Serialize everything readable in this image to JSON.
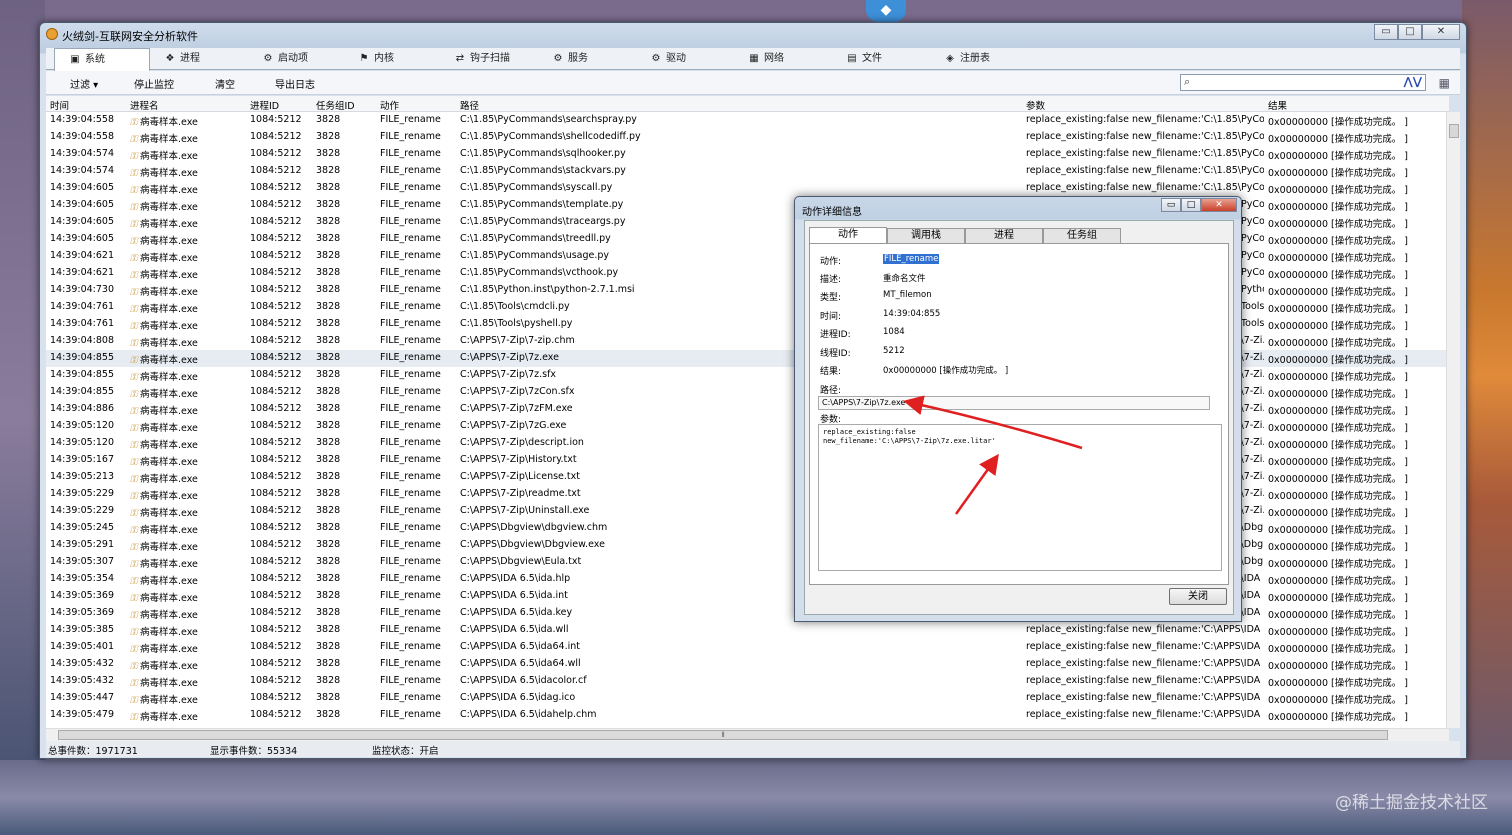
{
  "window": {
    "title": "火绒剑-互联网安全分析软件",
    "minimize": "▭",
    "maximize": "□",
    "close": "✕"
  },
  "tabs": [
    {
      "label": "系统",
      "icon": "▣",
      "active": true
    },
    {
      "label": "进程",
      "icon": "❖"
    },
    {
      "label": "启动项",
      "icon": "⚙"
    },
    {
      "label": "内核",
      "icon": "⚑"
    },
    {
      "label": "钩子扫描",
      "icon": "⇄"
    },
    {
      "label": "服务",
      "icon": "⚙"
    },
    {
      "label": "驱动",
      "icon": "⚙"
    },
    {
      "label": "网络",
      "icon": "▦"
    },
    {
      "label": "文件",
      "icon": "▤"
    },
    {
      "label": "注册表",
      "icon": "◈"
    }
  ],
  "toolbar": {
    "filter": "过滤 ▾",
    "stop": "停止监控",
    "clear": "清空",
    "export": "导出日志",
    "search_value": "",
    "search_icon": "⌕",
    "search_nav": "⋀⋁",
    "grid_icon": "▦"
  },
  "columns": {
    "time": "时间",
    "proc": "进程名",
    "pid": "进程ID",
    "tgid": "任务组ID",
    "action": "动作",
    "path": "路径",
    "param": "参数",
    "result": "结果"
  },
  "rows": [
    {
      "time": "14:39:04:558",
      "proc": "病毒样本.exe",
      "pid": "1084:5212",
      "tgid": "3828",
      "action": "FILE_rename",
      "path": "C:\\1.85\\PyCommands\\searchspray.py",
      "param": "replace_existing:false new_filename:'C:\\1.85\\PyCo...",
      "result": "0x00000000 [操作成功完成。 ]"
    },
    {
      "time": "14:39:04:558",
      "proc": "病毒样本.exe",
      "pid": "1084:5212",
      "tgid": "3828",
      "action": "FILE_rename",
      "path": "C:\\1.85\\PyCommands\\shellcodediff.py",
      "param": "replace_existing:false new_filename:'C:\\1.85\\PyCo...",
      "result": "0x00000000 [操作成功完成。 ]"
    },
    {
      "time": "14:39:04:574",
      "proc": "病毒样本.exe",
      "pid": "1084:5212",
      "tgid": "3828",
      "action": "FILE_rename",
      "path": "C:\\1.85\\PyCommands\\sqlhooker.py",
      "param": "replace_existing:false new_filename:'C:\\1.85\\PyCo...",
      "result": "0x00000000 [操作成功完成。 ]"
    },
    {
      "time": "14:39:04:574",
      "proc": "病毒样本.exe",
      "pid": "1084:5212",
      "tgid": "3828",
      "action": "FILE_rename",
      "path": "C:\\1.85\\PyCommands\\stackvars.py",
      "param": "replace_existing:false new_filename:'C:\\1.85\\PyCo...",
      "result": "0x00000000 [操作成功完成。 ]"
    },
    {
      "time": "14:39:04:605",
      "proc": "病毒样本.exe",
      "pid": "1084:5212",
      "tgid": "3828",
      "action": "FILE_rename",
      "path": "C:\\1.85\\PyCommands\\syscall.py",
      "param": "replace_existing:false new_filename:'C:\\1.85\\PyCo...",
      "result": "0x00000000 [操作成功完成。 ]"
    },
    {
      "time": "14:39:04:605",
      "proc": "病毒样本.exe",
      "pid": "1084:5212",
      "tgid": "3828",
      "action": "FILE_rename",
      "path": "C:\\1.85\\PyCommands\\template.py",
      "param": "replace_existing:false new_filename:'C:\\1.85\\PyCo...",
      "result": "0x00000000 [操作成功完成。 ]"
    },
    {
      "time": "14:39:04:605",
      "proc": "病毒样本.exe",
      "pid": "1084:5212",
      "tgid": "3828",
      "action": "FILE_rename",
      "path": "C:\\1.85\\PyCommands\\traceargs.py",
      "param": "replace_existing:false new_filename:'C:\\1.85\\PyCo...",
      "result": "0x00000000 [操作成功完成。 ]"
    },
    {
      "time": "14:39:04:605",
      "proc": "病毒样本.exe",
      "pid": "1084:5212",
      "tgid": "3828",
      "action": "FILE_rename",
      "path": "C:\\1.85\\PyCommands\\treedll.py",
      "param": "replace_existing:false new_filename:'C:\\1.85\\PyCo...",
      "result": "0x00000000 [操作成功完成。 ]"
    },
    {
      "time": "14:39:04:621",
      "proc": "病毒样本.exe",
      "pid": "1084:5212",
      "tgid": "3828",
      "action": "FILE_rename",
      "path": "C:\\1.85\\PyCommands\\usage.py",
      "param": "replace_existing:false new_filename:'C:\\1.85\\PyCo...",
      "result": "0x00000000 [操作成功完成。 ]"
    },
    {
      "time": "14:39:04:621",
      "proc": "病毒样本.exe",
      "pid": "1084:5212",
      "tgid": "3828",
      "action": "FILE_rename",
      "path": "C:\\1.85\\PyCommands\\vcthook.py",
      "param": "replace_existing:false new_filename:'C:\\1.85\\PyCo...",
      "result": "0x00000000 [操作成功完成。 ]"
    },
    {
      "time": "14:39:04:730",
      "proc": "病毒样本.exe",
      "pid": "1084:5212",
      "tgid": "3828",
      "action": "FILE_rename",
      "path": "C:\\1.85\\Python.inst\\python-2.7.1.msi",
      "param": "replace_existing:false new_filename:'C:\\1.85\\Pytho...",
      "result": "0x00000000 [操作成功完成。 ]"
    },
    {
      "time": "14:39:04:761",
      "proc": "病毒样本.exe",
      "pid": "1084:5212",
      "tgid": "3828",
      "action": "FILE_rename",
      "path": "C:\\1.85\\Tools\\cmdcli.py",
      "param": "replace_existing:false new_filename:'C:\\1.85\\Tools...",
      "result": "0x00000000 [操作成功完成。 ]"
    },
    {
      "time": "14:39:04:761",
      "proc": "病毒样本.exe",
      "pid": "1084:5212",
      "tgid": "3828",
      "action": "FILE_rename",
      "path": "C:\\1.85\\Tools\\pyshell.py",
      "param": "replace_existing:false new_filename:'C:\\1.85\\Tools...",
      "result": "0x00000000 [操作成功完成。 ]"
    },
    {
      "time": "14:39:04:808",
      "proc": "病毒样本.exe",
      "pid": "1084:5212",
      "tgid": "3828",
      "action": "FILE_rename",
      "path": "C:\\APPS\\7-Zip\\7-zip.chm",
      "param": "replace_existing:false new_filename:'C:\\APPS\\7-Zi...",
      "result": "0x00000000 [操作成功完成。 ]"
    },
    {
      "time": "14:39:04:855",
      "proc": "病毒样本.exe",
      "pid": "1084:5212",
      "tgid": "3828",
      "action": "FILE_rename",
      "path": "C:\\APPS\\7-Zip\\7z.exe",
      "param": "replace_existing:false new_filename:'C:\\APPS\\7-Zi...",
      "result": "0x00000000 [操作成功完成。 ]",
      "selected": true
    },
    {
      "time": "14:39:04:855",
      "proc": "病毒样本.exe",
      "pid": "1084:5212",
      "tgid": "3828",
      "action": "FILE_rename",
      "path": "C:\\APPS\\7-Zip\\7z.sfx",
      "param": "replace_existing:false new_filename:'C:\\APPS\\7-Zi...",
      "result": "0x00000000 [操作成功完成。 ]"
    },
    {
      "time": "14:39:04:855",
      "proc": "病毒样本.exe",
      "pid": "1084:5212",
      "tgid": "3828",
      "action": "FILE_rename",
      "path": "C:\\APPS\\7-Zip\\7zCon.sfx",
      "param": "replace_existing:false new_filename:'C:\\APPS\\7-Zi...",
      "result": "0x00000000 [操作成功完成。 ]"
    },
    {
      "time": "14:39:04:886",
      "proc": "病毒样本.exe",
      "pid": "1084:5212",
      "tgid": "3828",
      "action": "FILE_rename",
      "path": "C:\\APPS\\7-Zip\\7zFM.exe",
      "param": "replace_existing:false new_filename:'C:\\APPS\\7-Zi...",
      "result": "0x00000000 [操作成功完成。 ]"
    },
    {
      "time": "14:39:05:120",
      "proc": "病毒样本.exe",
      "pid": "1084:5212",
      "tgid": "3828",
      "action": "FILE_rename",
      "path": "C:\\APPS\\7-Zip\\7zG.exe",
      "param": "replace_existing:false new_filename:'C:\\APPS\\7-Zi...",
      "result": "0x00000000 [操作成功完成。 ]"
    },
    {
      "time": "14:39:05:120",
      "proc": "病毒样本.exe",
      "pid": "1084:5212",
      "tgid": "3828",
      "action": "FILE_rename",
      "path": "C:\\APPS\\7-Zip\\descript.ion",
      "param": "replace_existing:false new_filename:'C:\\APPS\\7-Zi...",
      "result": "0x00000000 [操作成功完成。 ]"
    },
    {
      "time": "14:39:05:167",
      "proc": "病毒样本.exe",
      "pid": "1084:5212",
      "tgid": "3828",
      "action": "FILE_rename",
      "path": "C:\\APPS\\7-Zip\\History.txt",
      "param": "replace_existing:false new_filename:'C:\\APPS\\7-Zi...",
      "result": "0x00000000 [操作成功完成。 ]"
    },
    {
      "time": "14:39:05:213",
      "proc": "病毒样本.exe",
      "pid": "1084:5212",
      "tgid": "3828",
      "action": "FILE_rename",
      "path": "C:\\APPS\\7-Zip\\License.txt",
      "param": "replace_existing:false new_filename:'C:\\APPS\\7-Zi...",
      "result": "0x00000000 [操作成功完成。 ]"
    },
    {
      "time": "14:39:05:229",
      "proc": "病毒样本.exe",
      "pid": "1084:5212",
      "tgid": "3828",
      "action": "FILE_rename",
      "path": "C:\\APPS\\7-Zip\\readme.txt",
      "param": "replace_existing:false new_filename:'C:\\APPS\\7-Zi...",
      "result": "0x00000000 [操作成功完成。 ]"
    },
    {
      "time": "14:39:05:229",
      "proc": "病毒样本.exe",
      "pid": "1084:5212",
      "tgid": "3828",
      "action": "FILE_rename",
      "path": "C:\\APPS\\7-Zip\\Uninstall.exe",
      "param": "replace_existing:false new_filename:'C:\\APPS\\7-Zi...",
      "result": "0x00000000 [操作成功完成。 ]"
    },
    {
      "time": "14:39:05:245",
      "proc": "病毒样本.exe",
      "pid": "1084:5212",
      "tgid": "3828",
      "action": "FILE_rename",
      "path": "C:\\APPS\\Dbgview\\dbgview.chm",
      "param": "replace_existing:false new_filename:'C:\\APPS\\Dbg...",
      "result": "0x00000000 [操作成功完成。 ]"
    },
    {
      "time": "14:39:05:291",
      "proc": "病毒样本.exe",
      "pid": "1084:5212",
      "tgid": "3828",
      "action": "FILE_rename",
      "path": "C:\\APPS\\Dbgview\\Dbgview.exe",
      "param": "replace_existing:false new_filename:'C:\\APPS\\Dbg...",
      "result": "0x00000000 [操作成功完成。 ]"
    },
    {
      "time": "14:39:05:307",
      "proc": "病毒样本.exe",
      "pid": "1084:5212",
      "tgid": "3828",
      "action": "FILE_rename",
      "path": "C:\\APPS\\Dbgview\\Eula.txt",
      "param": "replace_existing:false new_filename:'C:\\APPS\\Dbg...",
      "result": "0x00000000 [操作成功完成。 ]"
    },
    {
      "time": "14:39:05:354",
      "proc": "病毒样本.exe",
      "pid": "1084:5212",
      "tgid": "3828",
      "action": "FILE_rename",
      "path": "C:\\APPS\\IDA 6.5\\ida.hlp",
      "param": "replace_existing:false new_filename:'C:\\APPS\\IDA ...",
      "result": "0x00000000 [操作成功完成。 ]"
    },
    {
      "time": "14:39:05:369",
      "proc": "病毒样本.exe",
      "pid": "1084:5212",
      "tgid": "3828",
      "action": "FILE_rename",
      "path": "C:\\APPS\\IDA 6.5\\ida.int",
      "param": "replace_existing:false new_filename:'C:\\APPS\\IDA ...",
      "result": "0x00000000 [操作成功完成。 ]"
    },
    {
      "time": "14:39:05:369",
      "proc": "病毒样本.exe",
      "pid": "1084:5212",
      "tgid": "3828",
      "action": "FILE_rename",
      "path": "C:\\APPS\\IDA 6.5\\ida.key",
      "param": "replace_existing:false new_filename:'C:\\APPS\\IDA ...",
      "result": "0x00000000 [操作成功完成。 ]"
    },
    {
      "time": "14:39:05:385",
      "proc": "病毒样本.exe",
      "pid": "1084:5212",
      "tgid": "3828",
      "action": "FILE_rename",
      "path": "C:\\APPS\\IDA 6.5\\ida.wll",
      "param": "replace_existing:false new_filename:'C:\\APPS\\IDA ...",
      "result": "0x00000000 [操作成功完成。 ]"
    },
    {
      "time": "14:39:05:401",
      "proc": "病毒样本.exe",
      "pid": "1084:5212",
      "tgid": "3828",
      "action": "FILE_rename",
      "path": "C:\\APPS\\IDA 6.5\\ida64.int",
      "param": "replace_existing:false new_filename:'C:\\APPS\\IDA ...",
      "result": "0x00000000 [操作成功完成。 ]"
    },
    {
      "time": "14:39:05:432",
      "proc": "病毒样本.exe",
      "pid": "1084:5212",
      "tgid": "3828",
      "action": "FILE_rename",
      "path": "C:\\APPS\\IDA 6.5\\ida64.wll",
      "param": "replace_existing:false new_filename:'C:\\APPS\\IDA ...",
      "result": "0x00000000 [操作成功完成。 ]"
    },
    {
      "time": "14:39:05:432",
      "proc": "病毒样本.exe",
      "pid": "1084:5212",
      "tgid": "3828",
      "action": "FILE_rename",
      "path": "C:\\APPS\\IDA 6.5\\idacolor.cf",
      "param": "replace_existing:false new_filename:'C:\\APPS\\IDA ...",
      "result": "0x00000000 [操作成功完成。 ]"
    },
    {
      "time": "14:39:05:447",
      "proc": "病毒样本.exe",
      "pid": "1084:5212",
      "tgid": "3828",
      "action": "FILE_rename",
      "path": "C:\\APPS\\IDA 6.5\\idag.ico",
      "param": "replace_existing:false new_filename:'C:\\APPS\\IDA ...",
      "result": "0x00000000 [操作成功完成。 ]"
    },
    {
      "time": "14:39:05:479",
      "proc": "病毒样本.exe",
      "pid": "1084:5212",
      "tgid": "3828",
      "action": "FILE_rename",
      "path": "C:\\APPS\\IDA 6.5\\idahelp.chm",
      "param": "replace_existing:false new_filename:'C:\\APPS\\IDA ...",
      "result": "0x00000000 [操作成功完成。 ]"
    }
  ],
  "status": {
    "total": "总事件数：1971731",
    "shown": "显示事件数：55334",
    "monitor": "监控状态：开启"
  },
  "dialog": {
    "title": "动作详细信息",
    "tabs": [
      "动作",
      "调用栈",
      "进程",
      "任务组"
    ],
    "labels": {
      "action": "动作:",
      "desc": "描述:",
      "type": "类型:",
      "time": "时间:",
      "pid": "进程ID:",
      "tid": "线程ID:",
      "result": "结果:",
      "path": "路径:",
      "param": "参数:"
    },
    "values": {
      "action": "FILE_rename",
      "desc": "重命名文件",
      "type": "MT_filemon",
      "time": "14:39:04:855",
      "pid": "1084",
      "tid": "5212",
      "result": "0x00000000 [操作成功完成。 ]",
      "path": "C:\\APPS\\7-Zip\\7z.exe"
    },
    "param_lines": [
      "replace_existing:false",
      "new_filename:'C:\\APPS\\7-Zip\\7z.exe.litar'"
    ],
    "close": "关闭"
  },
  "watermark": "@稀土掘金技术社区",
  "colors": {
    "annotation_arrow": "#e02020",
    "selection": "#3070d0"
  }
}
